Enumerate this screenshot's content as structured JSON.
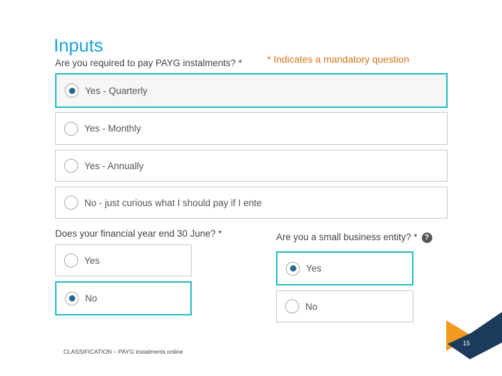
{
  "slide": {
    "title": "Inputs",
    "mandatory_note": "* Indicates a mandatory question",
    "classification": "CLASSIFICATION – PAYG instalments online",
    "page_number": "15"
  },
  "q1": {
    "question": "Are you required to pay PAYG instalments? *",
    "options": [
      {
        "label": "Yes - Quarterly",
        "selected": true
      },
      {
        "label": "Yes - Monthly",
        "selected": false
      },
      {
        "label": "Yes - Annually",
        "selected": false
      },
      {
        "label": "No - just curious what I should pay if I enter",
        "selected": false
      }
    ]
  },
  "q2": {
    "question": "Does your financial year end 30 June? *",
    "options": [
      {
        "label": "Yes",
        "selected": false
      },
      {
        "label": "No",
        "selected": true
      }
    ]
  },
  "q3": {
    "question": "Are you a small business entity? *",
    "help_icon": "?",
    "options": [
      {
        "label": "Yes",
        "selected": true
      },
      {
        "label": "No",
        "selected": false
      }
    ]
  },
  "colors": {
    "title": "#1aa3d8",
    "mandatory": "#d9731a",
    "selected_border": "#22b8c9",
    "radio_dot": "#27688f",
    "corner_orange": "#f39a1e",
    "corner_navy": "#1b3a5c"
  }
}
